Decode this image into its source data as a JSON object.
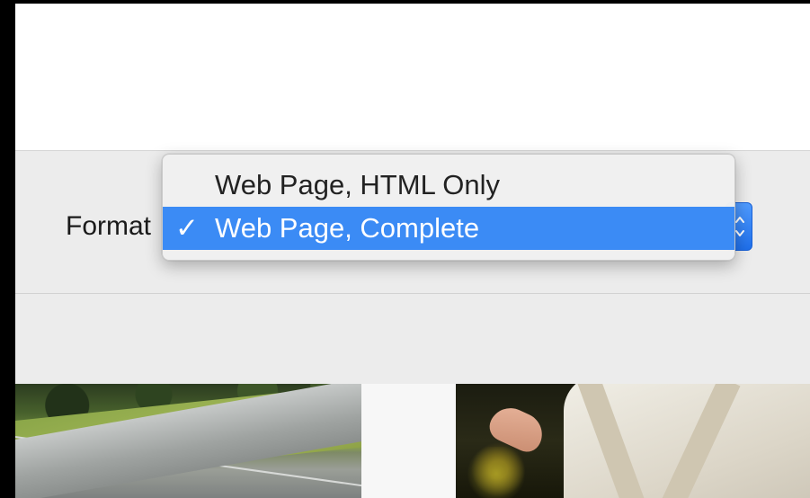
{
  "save_dialog": {
    "format_label": "Format",
    "format_selected": "Web Page, Complete",
    "format_options": [
      {
        "label": "Web Page, HTML Only",
        "checked": false,
        "highlighted": false
      },
      {
        "label": "Web Page, Complete",
        "checked": true,
        "highlighted": true
      }
    ],
    "check_glyph": "✓",
    "popup_arrows_glyph": "⌃⌄"
  },
  "colors": {
    "highlight": "#3b8bf5",
    "panel_bg": "#ececec",
    "popup_button": "#2f7ff0"
  },
  "icons": {
    "popup_arrows": "up-down-chevron-icon",
    "checkmark": "checkmark-icon"
  }
}
